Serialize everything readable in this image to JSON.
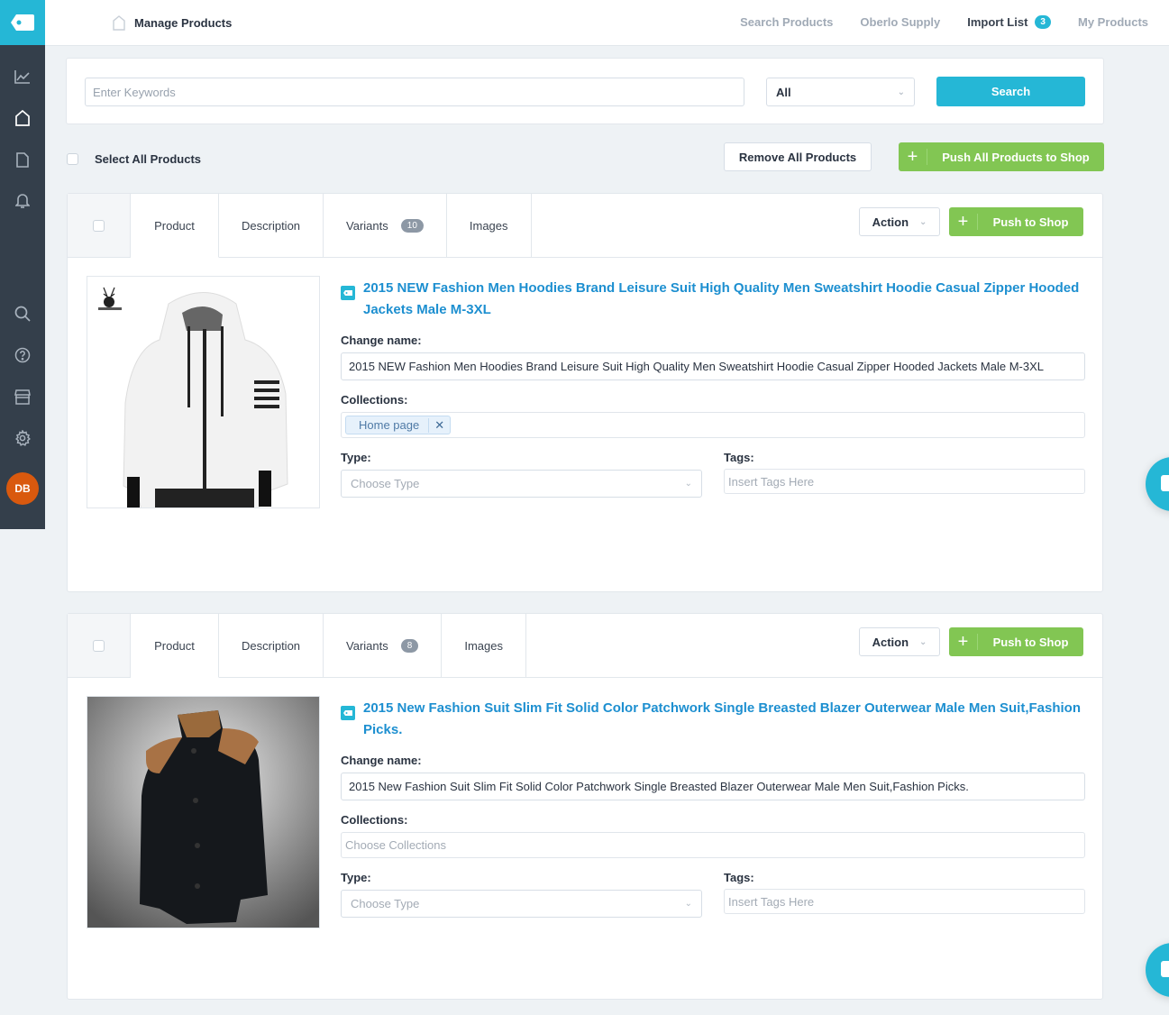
{
  "app": {
    "logo_icon": "price-tag-icon"
  },
  "sidebar": {
    "items": [
      {
        "name": "analytics",
        "icon": "line-chart-icon"
      },
      {
        "name": "products",
        "icon": "tag-icon",
        "active": true
      },
      {
        "name": "orders",
        "icon": "document-icon"
      },
      {
        "name": "notifications",
        "icon": "bell-icon"
      },
      {
        "name": "search",
        "icon": "search-icon"
      },
      {
        "name": "help",
        "icon": "question-icon"
      },
      {
        "name": "store",
        "icon": "store-icon"
      },
      {
        "name": "settings",
        "icon": "gear-icon"
      }
    ],
    "avatar": "DB"
  },
  "header": {
    "title": "Manage Products",
    "nav": [
      {
        "label": "Search Products"
      },
      {
        "label": "Oberlo Supply"
      },
      {
        "label": "Import List",
        "badge": "3",
        "active": true
      },
      {
        "label": "My Products"
      }
    ]
  },
  "search": {
    "keyword_placeholder": "Enter Keywords",
    "keyword_value": "",
    "filter_value": "All",
    "button": "Search"
  },
  "bulk": {
    "select_all": "Select All Products",
    "remove_all": "Remove All Products",
    "push_all": "Push All Products to Shop"
  },
  "labels": {
    "change_name": "Change name:",
    "collections": "Collections:",
    "type": "Type:",
    "tags": "Tags:",
    "type_placeholder": "Choose Type",
    "tags_placeholder": "Insert Tags Here",
    "collections_placeholder": "Choose Collections",
    "action": "Action",
    "push": "Push to Shop"
  },
  "products": [
    {
      "tabs": {
        "product": "Product",
        "description": "Description",
        "variants": "Variants",
        "variants_count": "10",
        "images": "Images"
      },
      "title": "2015 NEW Fashion Men Hoodies Brand Leisure Suit High Quality Men Sweatshirt Hoodie Casual Zipper Hooded Jackets Male M-3XL",
      "name_value": "2015 NEW Fashion Men Hoodies Brand Leisure Suit High Quality Men Sweatshirt Hoodie Casual Zipper Hooded Jackets Male M-3XL",
      "collections": [
        "Home page"
      ],
      "image": "white-hoodie"
    },
    {
      "tabs": {
        "product": "Product",
        "description": "Description",
        "variants": "Variants",
        "variants_count": "8",
        "images": "Images"
      },
      "title": "2015 New Fashion Suit Slim Fit Solid Color Patchwork Single Breasted Blazer Outerwear Male Men Suit,Fashion Picks.",
      "name_value": "2015 New Fashion Suit Slim Fit Solid Color Patchwork Single Breasted Blazer Outerwear Male Men Suit,Fashion Picks.",
      "collections": [],
      "image": "black-blazer"
    }
  ],
  "colors": {
    "accent": "#25b7d6",
    "green": "#82c653",
    "sidebar": "#343f4b",
    "link": "#1d8fd0",
    "avatar": "#d9590e"
  }
}
